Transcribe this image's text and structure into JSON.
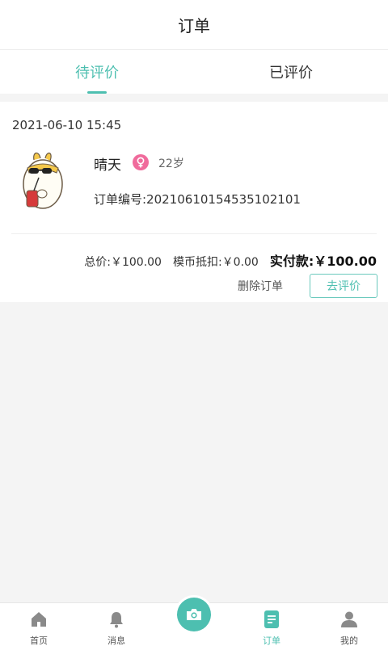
{
  "header": {
    "title": "订单"
  },
  "tabs": [
    {
      "label": "待评价",
      "active": true
    },
    {
      "label": "已评价",
      "active": false
    }
  ],
  "order": {
    "time": "2021-06-10 15:45",
    "user_name": "晴天",
    "gender_icon": "female-icon",
    "age": "22岁",
    "order_no": "订单编号:20210610154535102101",
    "total": "总价:￥100.00",
    "coin_deduct": "模币抵扣:￥0.00",
    "actual_pay": "实付款:￥100.00",
    "delete_label": "删除订单",
    "review_label": "去评价"
  },
  "tabbar": {
    "items": [
      {
        "label": "首页",
        "icon": "home-icon"
      },
      {
        "label": "消息",
        "icon": "bell-icon"
      },
      {
        "label": "",
        "icon": "camera-icon"
      },
      {
        "label": "订单",
        "icon": "order-icon",
        "active": true
      },
      {
        "label": "我的",
        "icon": "user-icon"
      }
    ]
  },
  "colors": {
    "accent": "#4dbfb0",
    "gender": "#f06b9c"
  }
}
